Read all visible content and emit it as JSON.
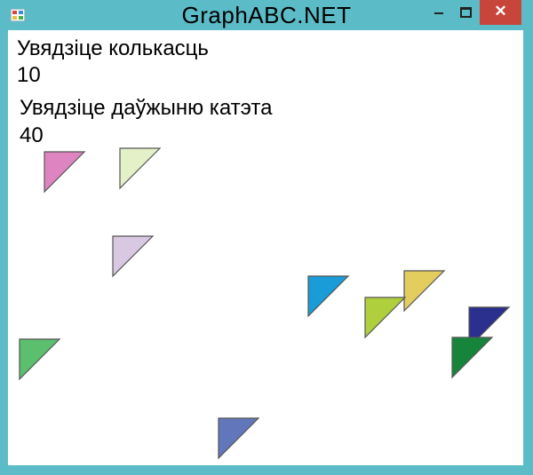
{
  "window": {
    "title": "GraphABC.NET",
    "close_glyph": "✕",
    "frame_color": "#5bbcc7",
    "close_color": "#c7453b"
  },
  "console": {
    "prompt_count": "Увядзіце колькасць",
    "value_count": "10",
    "prompt_leg": "Увядзіце даўжыню катэта",
    "value_leg": "40"
  },
  "triangles": [
    {
      "color": "#de85c1"
    },
    {
      "color": "#e3f0c8"
    },
    {
      "color": "#d9c8e1"
    },
    {
      "color": "#1a9cd8"
    },
    {
      "color": "#e3cd5f"
    },
    {
      "color": "#b0cf3c"
    },
    {
      "color": "#2b2f8e"
    },
    {
      "color": "#5bbf6e"
    },
    {
      "color": "#17843c"
    },
    {
      "color": "#6277bb"
    }
  ]
}
